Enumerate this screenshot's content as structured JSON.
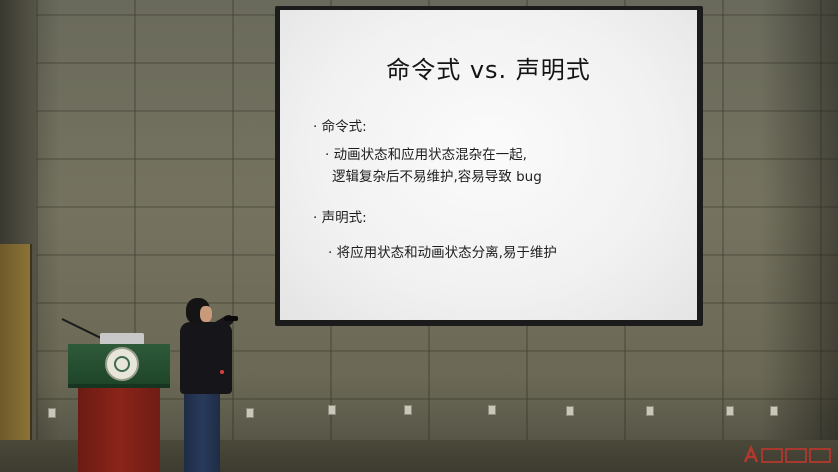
{
  "slide": {
    "title": "命令式 vs. 声明式",
    "bullet_1_heading": "· 命令式:",
    "bullet_1_line_1": "· 动画状态和应用状态混杂在一起,",
    "bullet_1_line_2": "逻辑复杂后不易维护,容易导致 bug",
    "bullet_2_heading": "· 声明式:",
    "bullet_2_line_1": "· 将应用状态和动画状态分离,易于维护"
  },
  "colors": {
    "screen_background": "#f5f5f5",
    "slide_text": "#1c1c1c",
    "lectern_green": "#2e5a3a",
    "lectern_red": "#8b2419",
    "watermark_red": "#d8342c"
  },
  "icons": {
    "watermark": "logo-watermark-icon"
  }
}
